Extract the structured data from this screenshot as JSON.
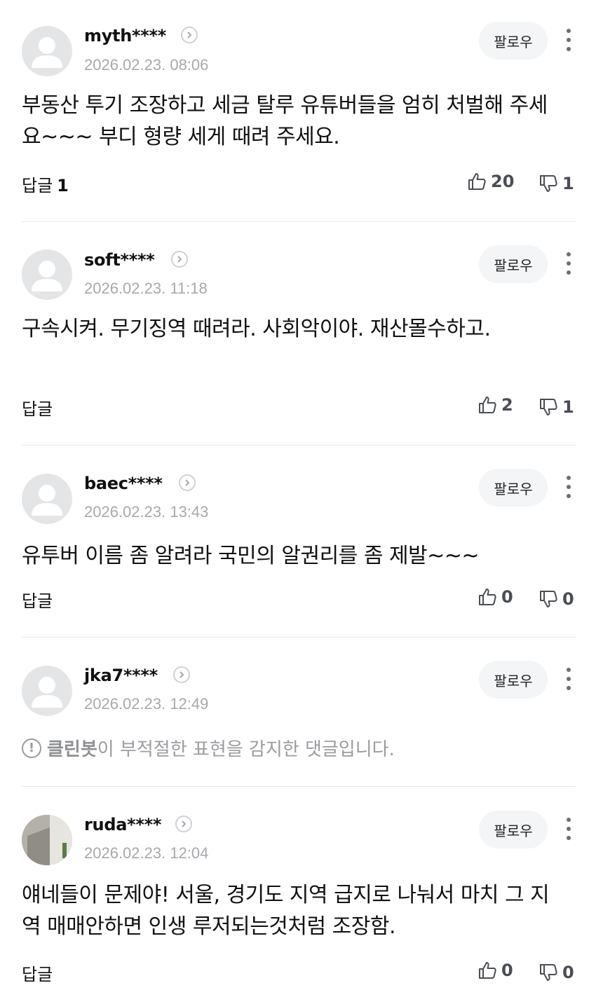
{
  "follow_label": "팔로우",
  "reply_label": "답글",
  "comments": [
    {
      "username": "myth****",
      "date": "2026.02.23. 08:06",
      "text": "부동산 투기 조장하고 세금 탈루 유튜버들을 엄히 처벌해 주세요~~~ 부디 형량 세게 때려 주세요.",
      "reply_count": "1",
      "likes": "20",
      "dislikes": "1"
    },
    {
      "username": "soft****",
      "date": "2026.02.23. 11:18",
      "text": "구속시켜. 무기징역 때려라. 사회악이야. 재산몰수하고.",
      "likes": "2",
      "dislikes": "1"
    },
    {
      "username": "baec****",
      "date": "2026.02.23. 13:43",
      "text": "유투버 이름 좀 알려라 국민의 알권리를 좀 제발~~~",
      "likes": "0",
      "dislikes": "0"
    },
    {
      "username": "jka7****",
      "date": "2026.02.23. 12:49",
      "cleanbot_name": "클린봇",
      "cleanbot_text": "이 부적절한 표현을 감지한 댓글입니다.",
      "warning_glyph": "!"
    },
    {
      "username": "ruda****",
      "date": "2026.02.23. 12:04",
      "text": "얘네들이 문제야! 서울, 경기도 지역 급지로 나눠서 마치 그 지역 매매안하면 인생 루저되는것처럼 조장함.",
      "likes": "0",
      "dislikes": "0"
    }
  ],
  "icons": {
    "avatar": "default-user-avatar",
    "chevron": "chevron-right-circle-icon",
    "more": "vertical-ellipsis-icon",
    "like": "thumbs-up-outline-icon",
    "dislike": "thumbs-down-outline-icon",
    "warning": "exclamation-circle-icon"
  },
  "colors": {
    "date": "#a7a9ad",
    "follow_bg": "#f4f5f7",
    "divider": "#e9eaec",
    "counter": "#4a4d52"
  }
}
